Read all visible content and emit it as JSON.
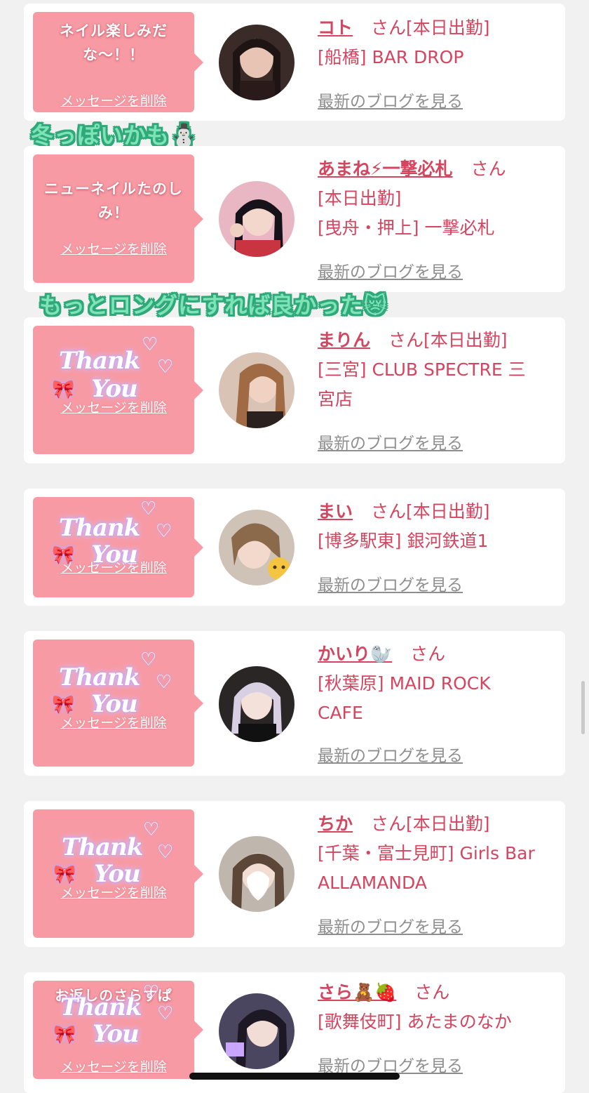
{
  "delete_label": "メッセージを削除",
  "blog_label": "最新のブログを見る",
  "san_label": "さん",
  "accent_color": "#d4455f",
  "bubble_color": "#f79aa4",
  "stickers": [
    {
      "text": "冬っぽいかも⛄"
    },
    {
      "text": "もっとロングにすれば良かった😿"
    }
  ],
  "thanks_sticker": {
    "word1": "Thank",
    "word2": "You"
  },
  "cards": [
    {
      "message": "ネイル楽しみだな〜！！",
      "name": "コト",
      "status": "[本日出勤]",
      "lines": [
        "[船橋] BAR DROP"
      ]
    },
    {
      "message": "ニューネイルたのしみ！",
      "name": "あまね⚡一撃必札",
      "status": "",
      "lines": [
        "[本日出勤]",
        "[曳舟・押上] 一撃必札"
      ]
    },
    {
      "message": "",
      "name": "まりん",
      "status": "[本日出勤]",
      "lines": [
        "[三宮] CLUB SPECTRE 三",
        "宮店"
      ]
    },
    {
      "message": "",
      "name": "まい",
      "status": "[本日出勤]",
      "lines": [
        "[博多駅東] 銀河鉄道1"
      ]
    },
    {
      "message": "",
      "name": "かいり🦭",
      "status": "",
      "lines": [
        "[秋葉原] MAID ROCK",
        "CAFE"
      ]
    },
    {
      "message": "",
      "name": "ちか",
      "status": "[本日出勤]",
      "lines": [
        "[千葉・富士見町] Girls Bar",
        "ALLAMANDA"
      ]
    },
    {
      "message": "お返しのさらすぱ",
      "name": "さら🧸🍓",
      "status": "",
      "lines": [
        "[歌舞伎町] あたまのなか"
      ]
    }
  ]
}
